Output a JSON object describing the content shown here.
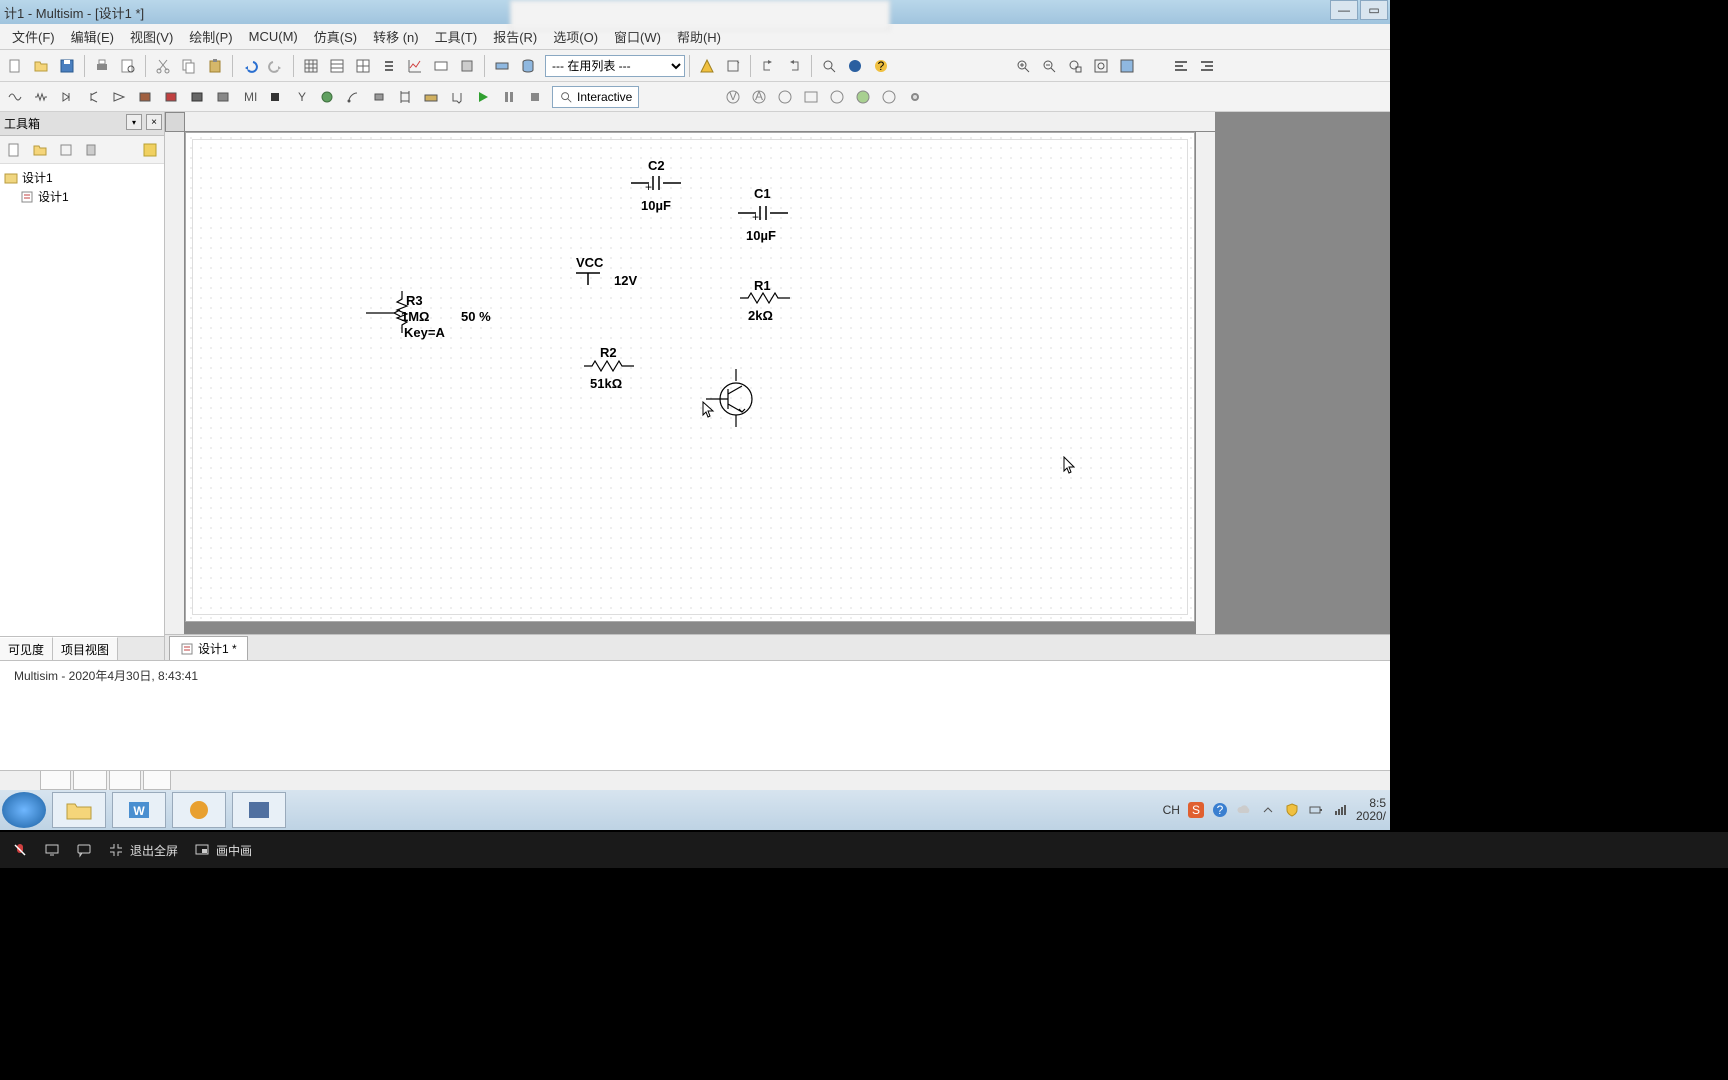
{
  "window": {
    "title": "计1 - Multisim - [设计1 *]"
  },
  "menus": [
    "文件(F)",
    "编辑(E)",
    "视图(V)",
    "绘制(P)",
    "MCU(M)",
    "仿真(S)",
    "转移 (n)",
    "工具(T)",
    "报告(R)",
    "选项(O)",
    "窗口(W)",
    "帮助(H)"
  ],
  "toolbar1": {
    "dropdown_value": "--- 在用列表 ---"
  },
  "toolbar2": {
    "interactive_label": "Interactive"
  },
  "side_panel": {
    "title": "工具箱",
    "tree_root": "设计1",
    "tree_child": "设计1",
    "tabs": [
      "可见度",
      "项目视图"
    ]
  },
  "doc_tab": "设计1 *",
  "status_log": "Multisim  -  2020年4月30日, 8:43:41",
  "components": {
    "c2_name": "C2",
    "c2_val": "10µF",
    "c1_name": "C1",
    "c1_val": "10µF",
    "vcc_name": "VCC",
    "vcc_val": "12V",
    "r1_name": "R1",
    "r1_val": "2kΩ",
    "r3_name": "R3",
    "r3_val": "1MΩ",
    "r3_pct": "50 %",
    "r3_key": "Key=A",
    "r2_name": "R2",
    "r2_val": "51kΩ"
  },
  "overlay": {
    "exit_fs": "退出全屏",
    "pip": "画中画"
  },
  "tray": {
    "ime": "CH",
    "time": "8:5",
    "date": "2020/"
  }
}
